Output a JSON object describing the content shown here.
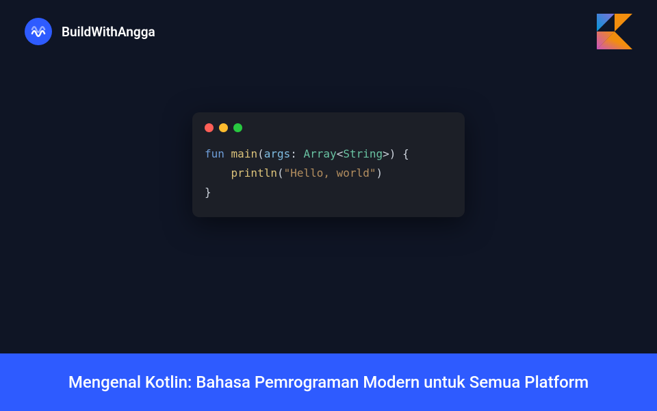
{
  "brand": {
    "name": "BuildWithAngga",
    "logo_icon": "wave-logo-icon"
  },
  "kotlin_logo": "kotlin-logo-icon",
  "traffic_colors": {
    "red": "#ff5f57",
    "yellow": "#febc2e",
    "green": "#28c840"
  },
  "code": {
    "line1_keyword": "fun",
    "line1_func": "main",
    "line1_param": "args",
    "line1_colon": ":",
    "line1_type1": "Array",
    "line1_lt": "<",
    "line1_type2": "String",
    "line1_gt": ">",
    "line1_open": "(",
    "line1_close": ")",
    "line1_brace": "{",
    "line2_indent": "    ",
    "line2_func": "println",
    "line2_open": "(",
    "line2_string": "\"Hello, world\"",
    "line2_close": ")",
    "line3_brace": "}"
  },
  "footer": {
    "title": "Mengenal Kotlin: Bahasa Pemrograman Modern untuk Semua Platform"
  },
  "colors": {
    "background": "#0f1525",
    "code_window": "#1c1f27",
    "accent": "#2e5bff"
  }
}
